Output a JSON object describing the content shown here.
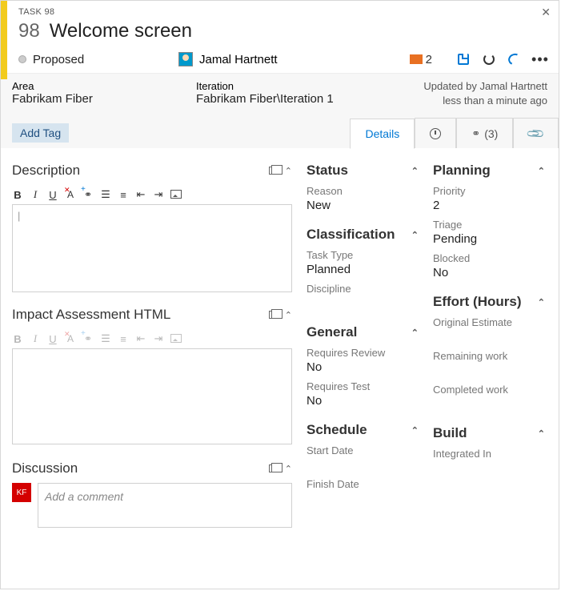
{
  "header": {
    "task_label": "TASK 98",
    "id": "98",
    "title": "Welcome screen",
    "state": "Proposed",
    "assignee": "Jamal Hartnett",
    "comment_count": "2"
  },
  "info": {
    "area_label": "Area",
    "area_value": "Fabrikam Fiber",
    "iteration_label": "Iteration",
    "iteration_value": "Fabrikam Fiber\\Iteration 1",
    "updated_by": "Updated by Jamal Hartnett",
    "updated_when": "less than a minute ago"
  },
  "tag_button": "Add Tag",
  "tabs": {
    "details": "Details",
    "links_count": "(3)"
  },
  "main": {
    "description_title": "Description",
    "impact_title": "Impact Assessment HTML",
    "discussion_title": "Discussion",
    "comment_placeholder": "Add a comment",
    "disc_initials": "KF"
  },
  "status": {
    "title": "Status",
    "reason_label": "Reason",
    "reason_value": "New",
    "classification_title": "Classification",
    "tasktype_label": "Task Type",
    "tasktype_value": "Planned",
    "discipline_label": "Discipline",
    "general_title": "General",
    "reqreview_label": "Requires Review",
    "reqreview_value": "No",
    "reqtest_label": "Requires Test",
    "reqtest_value": "No",
    "schedule_title": "Schedule",
    "start_label": "Start Date",
    "finish_label": "Finish Date"
  },
  "planning": {
    "title": "Planning",
    "priority_label": "Priority",
    "priority_value": "2",
    "triage_label": "Triage",
    "triage_value": "Pending",
    "blocked_label": "Blocked",
    "blocked_value": "No",
    "effort_title": "Effort (Hours)",
    "orig_label": "Original Estimate",
    "remain_label": "Remaining work",
    "complete_label": "Completed work",
    "build_title": "Build",
    "integrated_label": "Integrated In"
  }
}
